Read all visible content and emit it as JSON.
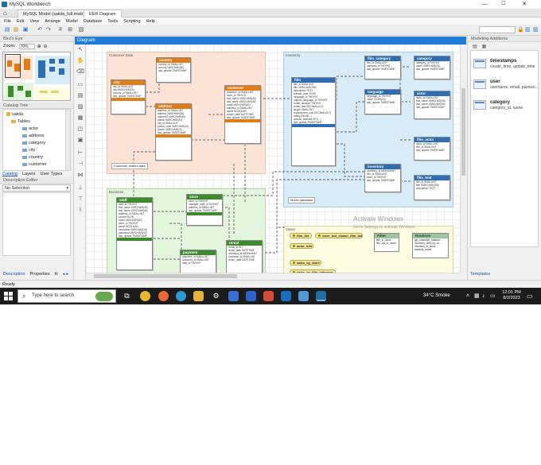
{
  "window": {
    "title": "MySQL Workbench",
    "minimize": "—",
    "maximize": "☐",
    "close": "✕"
  },
  "tabs": [
    {
      "label": "MySQL Model (sakila_full.mwb)"
    },
    {
      "label": "EER Diagram"
    }
  ],
  "menu": [
    "File",
    "Edit",
    "View",
    "Arrange",
    "Model",
    "Database",
    "Tools",
    "Scripting",
    "Help"
  ],
  "left_panel": {
    "birds_eye_title": "Bird's Eye",
    "zoom_label": "Zoom:",
    "zoom_value": "70%",
    "catalog_title": "Catalog Tree",
    "tree": {
      "schema": "sakila",
      "tables_folder": "Tables",
      "tables": [
        "actor",
        "address",
        "category",
        "city",
        "country",
        "customer"
      ]
    },
    "subtabs": [
      "Catalog",
      "Layers",
      "User Types"
    ],
    "description_title": "Description Editor",
    "selection": "No Selection",
    "bottom_tabs": [
      "Description",
      "Properties",
      "H"
    ]
  },
  "diagram": {
    "tab_title": "Diagram",
    "layers": [
      {
        "label": "Customer Data"
      },
      {
        "label": "Inventory"
      },
      {
        "label": "Business"
      },
      {
        "label": "Views"
      }
    ],
    "notes": [
      "Customer related data",
      "Movie database"
    ],
    "entities": {
      "country": {
        "title": "country",
        "fields": [
          "country_id SMALLINT",
          "country VARCHAR(50)",
          "last_update TIMESTAMP"
        ]
      },
      "city": {
        "title": "city",
        "fields": [
          "city_id SMALLINT",
          "city VARCHAR(50)",
          "country_id SMALLINT",
          "last_update TIMESTAMP"
        ]
      },
      "address": {
        "title": "address",
        "fields": [
          "address_id SMALLINT",
          "address VARCHAR(50)",
          "address2 VARCHAR(50)",
          "district VARCHAR(20)",
          "city_id SMALLINT",
          "postal_code VARCHAR(10)",
          "phone VARCHAR(20)",
          "last_update TIMESTAMP"
        ]
      },
      "customer": {
        "title": "customer",
        "fields": [
          "customer_id SMALLINT",
          "store_id TINYINT",
          "first_name VARCHAR(45)",
          "last_name VARCHAR(45)",
          "email VARCHAR(50)",
          "address_id SMALLINT",
          "active BOOLEAN",
          "create_date DATETIME",
          "last_update TIMESTAMP"
        ]
      },
      "film": {
        "title": "film",
        "fields": [
          "film_id SMALLINT",
          "title VARCHAR(255)",
          "description TEXT",
          "release_year YEAR",
          "language_id TINYINT",
          "original_language_id TINYINT",
          "rental_duration TINYINT",
          "rental_rate DECIMAL(4,2)",
          "length SMALLINT",
          "replacement_cost DECIMAL(5,2)",
          "rating ENUM(...)",
          "special_features SET(...)",
          "last_update TIMESTAMP"
        ]
      },
      "film_category": {
        "title": "film_category",
        "fields": [
          "film_id SMALLINT",
          "category_id TINYINT",
          "last_update TIMESTAMP"
        ]
      },
      "category": {
        "title": "category",
        "fields": [
          "category_id TINYINT",
          "name VARCHAR(25)",
          "last_update TIMESTAMP"
        ]
      },
      "language": {
        "title": "language",
        "fields": [
          "language_id TINYINT",
          "name CHAR(20)",
          "last_update TIMESTAMP"
        ]
      },
      "actor": {
        "title": "actor",
        "fields": [
          "actor_id SMALLINT",
          "first_name VARCHAR(45)",
          "last_name VARCHAR(45)",
          "last_update TIMESTAMP"
        ]
      },
      "film_actor": {
        "title": "film_actor",
        "fields": [
          "actor_id SMALLINT",
          "film_id SMALLINT",
          "last_update TIMESTAMP"
        ]
      },
      "inventory": {
        "title": "inventory",
        "fields": [
          "inventory_id MEDIUMINT",
          "film_id SMALLINT",
          "store_id TINYINT",
          "last_update TIMESTAMP"
        ]
      },
      "film_text": {
        "title": "film_text",
        "fields": [
          "film_id SMALLINT",
          "title VARCHAR(255)",
          "description TEXT"
        ]
      },
      "staff": {
        "title": "staff",
        "fields": [
          "staff_id TINYINT",
          "first_name VARCHAR(45)",
          "last_name VARCHAR(45)",
          "address_id SMALLINT",
          "picture BLOB",
          "email VARCHAR(50)",
          "store_id TINYINT",
          "active BOOLEAN",
          "username VARCHAR(16)",
          "password VARCHAR(40)",
          "last_update TIMESTAMP"
        ]
      },
      "store": {
        "title": "store",
        "fields": [
          "store_id TINYINT",
          "manager_staff_id TINYINT",
          "address_id SMALLINT",
          "last_update TIMESTAMP"
        ]
      },
      "payment": {
        "title": "payment",
        "fields": [
          "payment_id SMALLINT",
          "customer_id SMALLINT",
          "staff_id TINYINT"
        ]
      },
      "rental": {
        "title": "rental",
        "fields": [
          "rental_id INT",
          "rental_date DATETIME",
          "inventory_id MEDIUMINT",
          "customer_id SMALLINT",
          "return_date DATETIME"
        ]
      }
    },
    "views": [
      "film_list",
      "nicer_but_slower_film_list",
      "actor_info",
      "sales_by_store",
      "sales_by_film_category"
    ],
    "routines": {
      "filter": {
        "title": "Filter",
        "fields": [
          "film_in_stock",
          "film_not_in_stock"
        ]
      },
      "routines": {
        "title": "Routines",
        "fields": [
          "get_customer_balance",
          "inventory_held_by_cu...",
          "inventory_in_stock",
          "rewards_report"
        ]
      }
    },
    "watermark": "Activate Windows",
    "watermark_sub": "Go to Settings to activate Windows."
  },
  "right_panel": {
    "title": "Modeling Additions",
    "templates": [
      {
        "name": "timestamps",
        "desc": "create_time, update_time"
      },
      {
        "name": "user",
        "desc": "username, email, passwo..."
      },
      {
        "name": "category",
        "desc": "category_id, name"
      }
    ],
    "bottom_tab": "Templates"
  },
  "status": {
    "text": "Ready"
  },
  "taskbar": {
    "search_placeholder": "Type here to search",
    "weather": "34°C  Smoke",
    "time": "12:01 PM",
    "date": "8/2/2023"
  },
  "colors": {
    "accent": "#1e7cd6",
    "entity_orange": "#e07d18",
    "entity_blue": "#2c6db3",
    "entity_green": "#3c8c2c",
    "layer_customer": "#fbe4d6",
    "layer_inventory": "#d8ecf8",
    "layer_business": "#e3f5dc",
    "layer_views": "#fdfbe0"
  }
}
